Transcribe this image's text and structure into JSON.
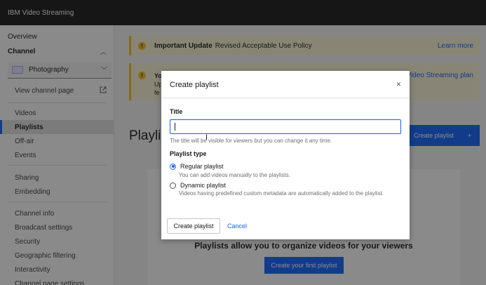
{
  "app": {
    "title": "IBM Video Streaming"
  },
  "sidebar": {
    "overview": "Overview",
    "channel_label": "Channel",
    "channel_select": "Photography",
    "view_channel_page": "View channel page",
    "group1": [
      "Videos",
      "Playlists",
      "Off-air",
      "Events"
    ],
    "group2": [
      "Sharing",
      "Embedding"
    ],
    "group3": [
      "Channel info",
      "Broadcast settings",
      "Security",
      "Geographic filtering",
      "Interactivity",
      "Channel page settings"
    ],
    "active_item": "Playlists"
  },
  "banners": {
    "update": {
      "title": "Important Update",
      "text": "Revised Acceptable Use Policy",
      "link": "Learn more"
    },
    "second": {
      "line1": "Yo",
      "line2": "Up",
      "line3": "fe",
      "link": "Video Streaming plan"
    }
  },
  "page": {
    "title": "Playlis",
    "create_button": "Create playlist",
    "create_button_icon": "+",
    "empty_title": "Playlists allow you to organize videos for your viewers",
    "empty_button": "Create your first playlist"
  },
  "modal": {
    "title": "Create playlist",
    "close_icon": "×",
    "field_label": "Title",
    "field_value": "",
    "field_help": "The title will be visible for viewers but you can change it any time.",
    "type_label": "Playlist type",
    "options": [
      {
        "label": "Regular playlist",
        "desc": "You can add videos manually to the playlists.",
        "checked": true
      },
      {
        "label": "Dynamic playlist",
        "desc": "Videos having predefined custom metadata are automatically added to the playlist.",
        "checked": false
      }
    ],
    "create_button": "Create playlist",
    "cancel_link": "Cancel"
  },
  "colors": {
    "accent": "#0f62fe",
    "warning": "#f1c21b",
    "topbar": "#161616"
  }
}
